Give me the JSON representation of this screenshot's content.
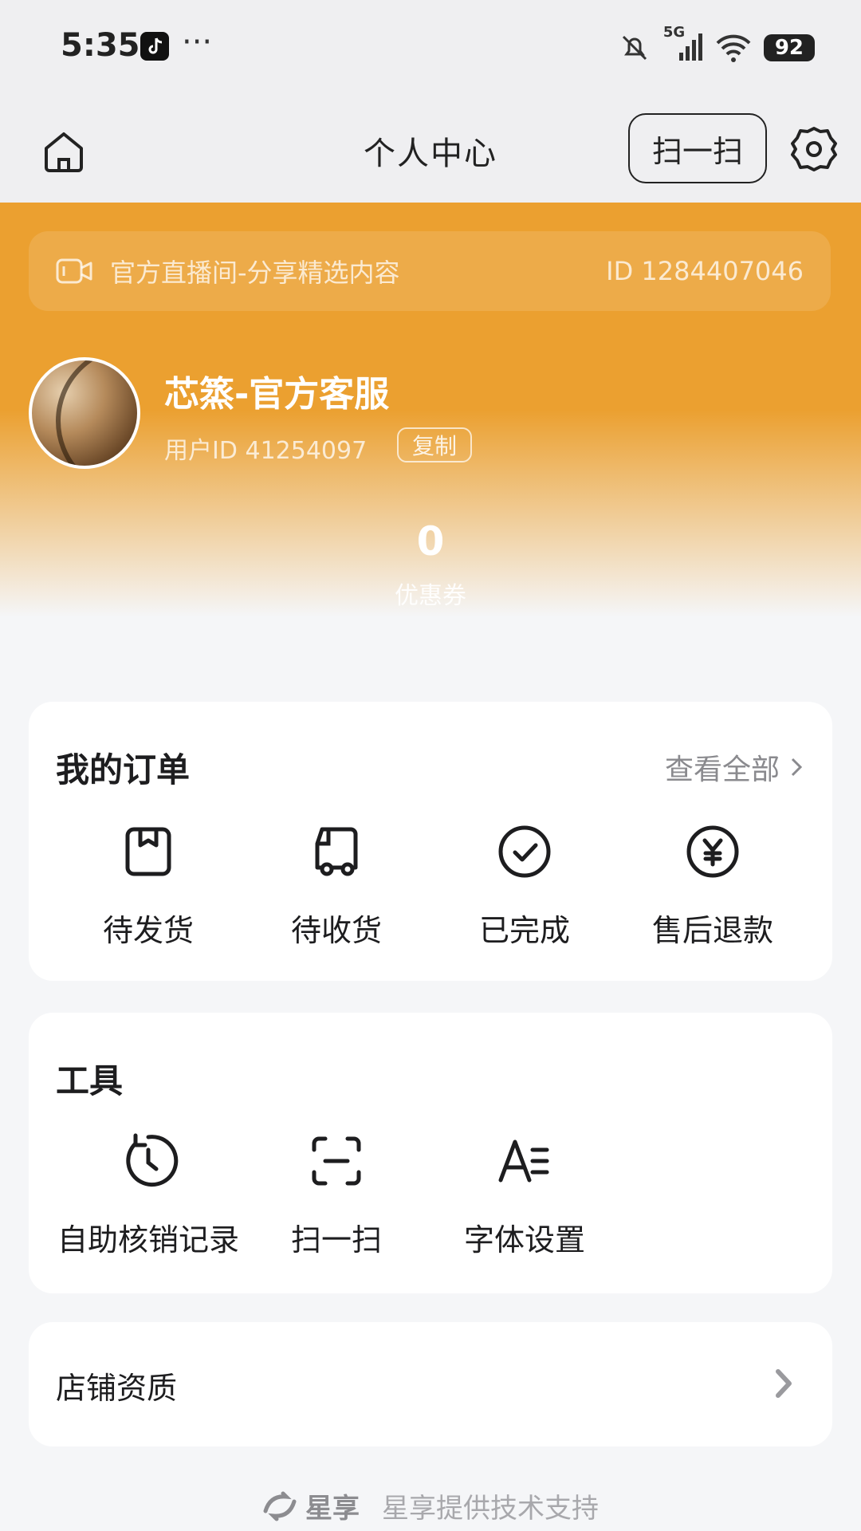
{
  "status_bar": {
    "time": "5:35",
    "more": "···",
    "network": "5G",
    "battery": "92"
  },
  "header": {
    "title": "个人中心",
    "scan_label": "扫一扫"
  },
  "live_banner": {
    "text": "官方直播间-分享精选内容",
    "id": "ID 1284407046"
  },
  "profile": {
    "name": "芯篜-官方客服",
    "user_id": "用户ID 41254097",
    "copy_label": "复制"
  },
  "coupon": {
    "count": "0",
    "label": "优惠券"
  },
  "orders": {
    "title": "我的订单",
    "view_all": "查看全部",
    "items": [
      {
        "label": "待发货",
        "icon": "box-icon"
      },
      {
        "label": "待收货",
        "icon": "truck-icon"
      },
      {
        "label": "已完成",
        "icon": "check-circle-icon"
      },
      {
        "label": "售后退款",
        "icon": "yuan-circle-icon"
      }
    ]
  },
  "tools": {
    "title": "工具",
    "items": [
      {
        "label": "自助核销记录",
        "icon": "history-icon"
      },
      {
        "label": "扫一扫",
        "icon": "scan-icon"
      },
      {
        "label": "字体设置",
        "icon": "font-icon"
      }
    ]
  },
  "shop": {
    "label": "店铺资质"
  },
  "footer": {
    "brand": "星享",
    "support": "星享提供技术支持"
  },
  "colors": {
    "accent": "#eba030",
    "background": "#f5f6f8",
    "card": "#ffffff"
  }
}
